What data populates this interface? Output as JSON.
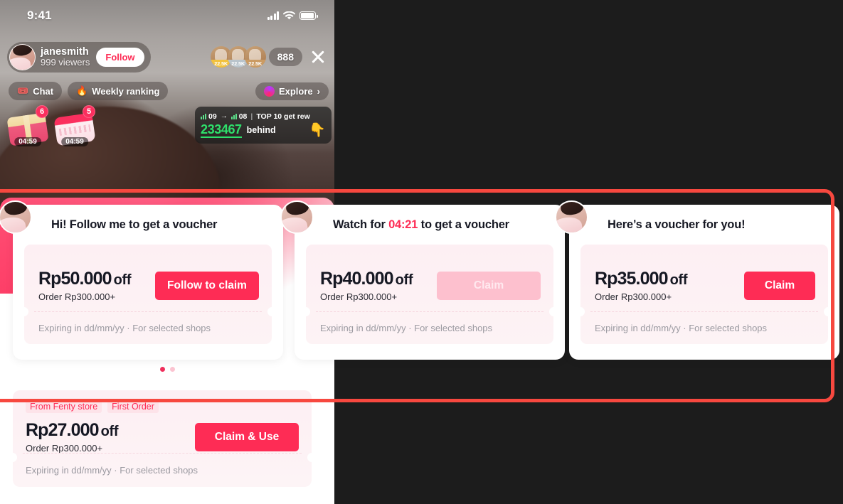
{
  "status_bar": {
    "time": "9:41",
    "signal_icon": "signal-bars-icon",
    "wifi_icon": "wifi-icon",
    "battery_icon": "battery-icon"
  },
  "live_header": {
    "creator_name": "janesmith",
    "viewers": "999 viewers",
    "follow_label": "Follow",
    "top_viewers": [
      {
        "rank_label": "22.5K",
        "tier": "gold"
      },
      {
        "rank_label": "22.5K",
        "tier": "silver"
      },
      {
        "rank_label": "22.5K",
        "tier": "bronze"
      }
    ],
    "viewer_count": "888",
    "close_icon": "close-icon"
  },
  "chips": [
    {
      "icon": "chat-emoji",
      "glyph": "🎟️",
      "label": "Chat"
    },
    {
      "icon": "fire-emoji",
      "glyph": "🔥",
      "label": "Weekly ranking"
    }
  ],
  "explore": {
    "label": "Explore",
    "chevron": "›",
    "orb_icon": "explore-orb-icon"
  },
  "gifts": [
    {
      "badge": "6",
      "timer": "04:59",
      "icon": "treasure-chest-icon"
    },
    {
      "badge": "5",
      "timer": "04:59",
      "icon": "gift-box-icon"
    }
  ],
  "rank_widget": {
    "current_rank": "09",
    "arrow": "→",
    "target_rank": "08",
    "separator": "|",
    "note": "TOP 10 get rew",
    "score": "233467",
    "behind_label": "behind",
    "hand_icon": "pointing-hand-emoji",
    "hand_glyph": "👇"
  },
  "carousel": {
    "cards": [
      {
        "title_prefix": "Hi! Follow me to get a voucher",
        "title_highlight": "",
        "title_suffix": "",
        "amount": "Rp50.000",
        "amount_off": "off",
        "min_order": "Order Rp300.000+",
        "button_label": "Follow to claim",
        "button_state": "active",
        "expiry": "Expiring in dd/mm/yy · For selected shops"
      },
      {
        "title_prefix": "Watch for ",
        "title_highlight": "04:21",
        "title_suffix": " to get a voucher",
        "amount": "Rp40.000",
        "amount_off": "off",
        "min_order": "Order Rp300.000+",
        "button_label": "Claim",
        "button_state": "disabled",
        "expiry": "Expiring in dd/mm/yy · For selected shops"
      },
      {
        "title_prefix": "Here’s a voucher for you!",
        "title_highlight": "",
        "title_suffix": "",
        "amount": "Rp35.000",
        "amount_off": "off",
        "min_order": "Order Rp300.000+",
        "button_label": "Claim",
        "button_state": "active",
        "expiry": "Expiring in dd/mm/yy · For selected shops"
      }
    ],
    "pagination": {
      "total": 2,
      "active_index": 0
    }
  },
  "bottom_voucher": {
    "tags": [
      "From Fenty store",
      "First Order"
    ],
    "amount": "Rp27.000",
    "amount_off": "off",
    "min_order": "Order Rp300.000+",
    "button_label": "Claim & Use",
    "expiry": "Expiring in dd/mm/yy · For selected shops"
  },
  "colors": {
    "brand_red": "#fe2c55",
    "annotation_red": "#f7483f",
    "disabled_pink": "#fdc0ce",
    "ticket_bg": "#fdeff3",
    "rank_green": "#2ee06b",
    "page_bg": "#1c1c1c"
  }
}
